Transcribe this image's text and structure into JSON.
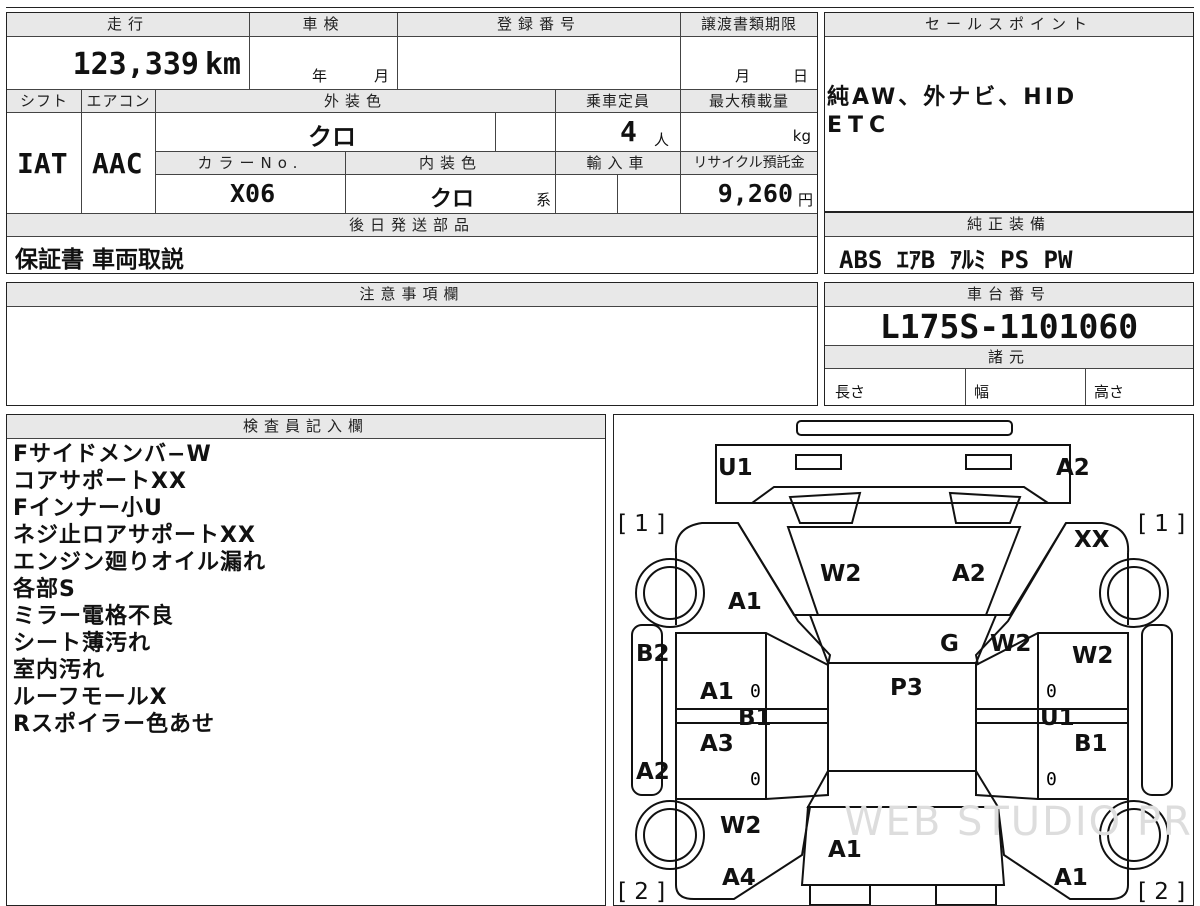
{
  "top_strip": {
    "partial": ""
  },
  "sheet": {
    "mileage": {
      "header": "走行",
      "value": "123,339",
      "unit": "km"
    },
    "inspection": {
      "header": "車検",
      "year_unit": "年",
      "month_unit": "月"
    },
    "registration": {
      "header": "登録番号"
    },
    "transfer_deadline": {
      "header": "譲渡書類期限",
      "month_unit": "月",
      "day_unit": "日"
    },
    "shift": {
      "header": "シフト",
      "value": "IAT"
    },
    "aircon": {
      "header": "エアコン",
      "value": "AAC"
    },
    "exterior_color": {
      "header": "外装色",
      "value": "クロ"
    },
    "capacity": {
      "header": "乗車定員",
      "value": "4",
      "unit": "人"
    },
    "max_load": {
      "header": "最大積載量",
      "unit": "kg"
    },
    "color_no": {
      "header": "カラーNo.",
      "value": "X06"
    },
    "interior_color": {
      "header": "内装色",
      "value": "クロ",
      "suffix": "系"
    },
    "import": {
      "header": "輸入車"
    },
    "recycle": {
      "header": "リサイクル預託金",
      "value": "9,260",
      "unit": "円"
    },
    "later_parts": {
      "header": "後日発送部品",
      "value": "保証書 車両取説"
    },
    "caution": {
      "header": "注意事項欄"
    }
  },
  "sales_points": {
    "header": "セールスポイント",
    "lines": [
      "純AW、外ナビ、HID",
      "ETC"
    ]
  },
  "equipment": {
    "header": "純正装備",
    "value": "ABS ｴｱB ｱﾙﾐ PS PW"
  },
  "chassis": {
    "header": "車台番号",
    "value": "L175S-1101060"
  },
  "specs": {
    "header": "諸元",
    "length": "長さ",
    "width": "幅",
    "height": "高さ"
  },
  "inspector": {
    "header": "検査員記入欄",
    "notes": [
      "Fサイドメンバ−W",
      "コアサポートXX",
      "Fインナー小U",
      "ネジ止ロアサポートXX",
      "エンジン廻りオイル漏れ",
      "各部S",
      "ミラー電格不良",
      "シート薄汚れ",
      "室内汚れ",
      "ルーフモールX",
      "Rスポイラー色あせ"
    ]
  },
  "diagram": {
    "watermark": "WEB STUDIO PRO",
    "corner_front_left": "[ 1 ]",
    "corner_front_right": "[ 1 ]",
    "corner_rear_left": "[ 2 ]",
    "corner_rear_right": "[ 2 ]",
    "marks": {
      "front_left_corner": "U1",
      "front_right_corner": "A2",
      "front_right_fender": "XX",
      "hood_left": "W2",
      "hood_right": "A2",
      "left_fender": "A1",
      "windshield": "G",
      "windshield_right": "W2",
      "right_front_door": "W2",
      "left_pillar": "B2",
      "left_front_door": "A1",
      "left_sill": "B1",
      "right_sill": "U1",
      "roof": "P3",
      "left_rear_door": "A3",
      "right_rear_door": "B1",
      "left_rear_pillar": "A2",
      "left_quarter": "W2",
      "rear_center": "A1",
      "left_rear_corner": "A4",
      "right_rear_corner": "A1",
      "door_mark": "0"
    }
  }
}
